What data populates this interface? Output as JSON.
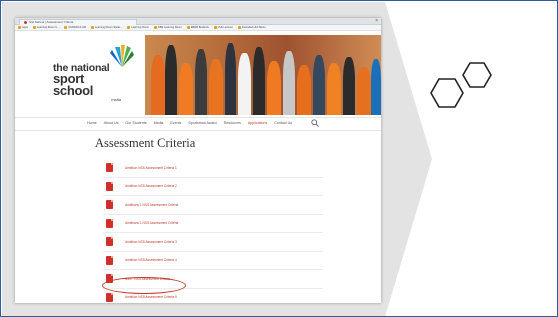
{
  "colors": {
    "frame_border": "#2e5b9a",
    "panel_gray": "#e3e3e3",
    "accent_red": "#c0392b",
    "pdf_red": "#d0302a"
  },
  "browser": {
    "tab_title": "Nisi Sehool | Assessment Criteria",
    "bookmarks": [
      "Apps",
      "Learning Room U...",
      "CURRICULUM",
      "Learning Room Stude...",
      "Learning Room",
      "DBE Learning Room",
      "EBDR Bookinfo",
      "VLE Lecturer",
      "Extended Hub Menu"
    ]
  },
  "site": {
    "logo": {
      "line1": "the national",
      "line2": "sport school",
      "line3": "malta"
    },
    "nav": {
      "items": [
        "Home",
        "About Us",
        "Our Students",
        "Media",
        "Events",
        "Sportsman Award",
        "Resources",
        "Applications",
        "Contact Us"
      ],
      "active_index": 7,
      "search_icon": "search-icon"
    },
    "page": {
      "heading": "Assessment Criteria",
      "documents": [
        "Ambition NSS Assessment Criteria 1",
        "Ambition NSS Assessment Criteria 2",
        "Ambitions 1 NSS Assessment Criteria",
        "Ambitions 1 NSS Assessment Criteria",
        "Ambition NSS Assessment Criteria 3",
        "Ambition NSS Assessment Criteria 4",
        "NSS - NSS Assessment Criteria",
        "Ambition NSS Assessment Criteria 5"
      ],
      "highlighted_index": 6
    }
  },
  "decor": {
    "hexagon_icon": "hexagon-pair-icon"
  }
}
